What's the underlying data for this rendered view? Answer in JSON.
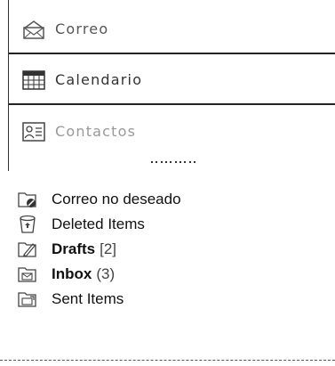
{
  "nav": {
    "items": [
      {
        "label": "Correo",
        "icon": "mail-icon"
      },
      {
        "label": "Calendario",
        "icon": "calendar-icon"
      },
      {
        "label": "Contactos",
        "icon": "contacts-icon"
      }
    ]
  },
  "folders": [
    {
      "name": "Correo no deseado",
      "bold": false,
      "count": "",
      "icon": "junk-folder-icon"
    },
    {
      "name": "Deleted Items",
      "bold": false,
      "count": "",
      "icon": "trash-icon"
    },
    {
      "name": "Drafts",
      "bold": true,
      "count": "[2]",
      "icon": "drafts-folder-icon"
    },
    {
      "name": "Inbox",
      "bold": true,
      "count": "(3)",
      "icon": "inbox-folder-icon"
    },
    {
      "name": "Sent Items",
      "bold": false,
      "count": "",
      "icon": "sent-folder-icon"
    }
  ]
}
